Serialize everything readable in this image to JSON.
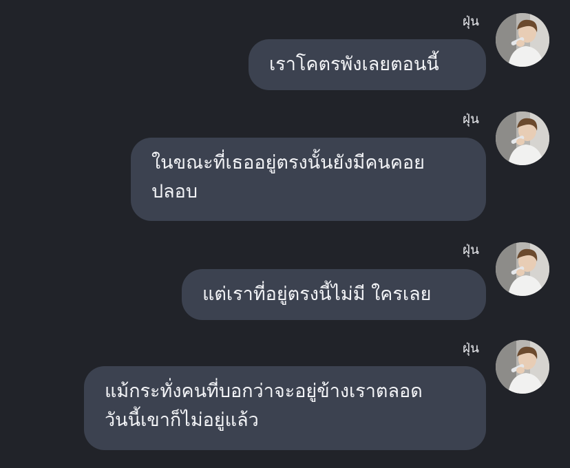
{
  "messages": [
    {
      "sender": "ฝุ่น",
      "lines": [
        "เราโคตรพังเลยตอนนี้"
      ]
    },
    {
      "sender": "ฝุ่น",
      "lines": [
        "ในขณะที่เธออยู่ตรงนั้นยังมีคนคอย",
        "ปลอบ"
      ]
    },
    {
      "sender": "ฝุ่น",
      "lines": [
        "แต่เราที่อยู่ตรงนี้ไม่มี ใครเลย"
      ]
    },
    {
      "sender": "ฝุ่น",
      "lines": [
        "แม้กระทั่งคนที่บอกว่าจะอยู่ข้างเราตลอด",
        "วันนี้เขาก็ไม่อยู่แล้ว"
      ]
    }
  ],
  "colors": {
    "background": "#212329",
    "bubble": "#3c4250",
    "text": "#f2f3f6"
  },
  "icons": {
    "avatar": "profile-photo"
  }
}
